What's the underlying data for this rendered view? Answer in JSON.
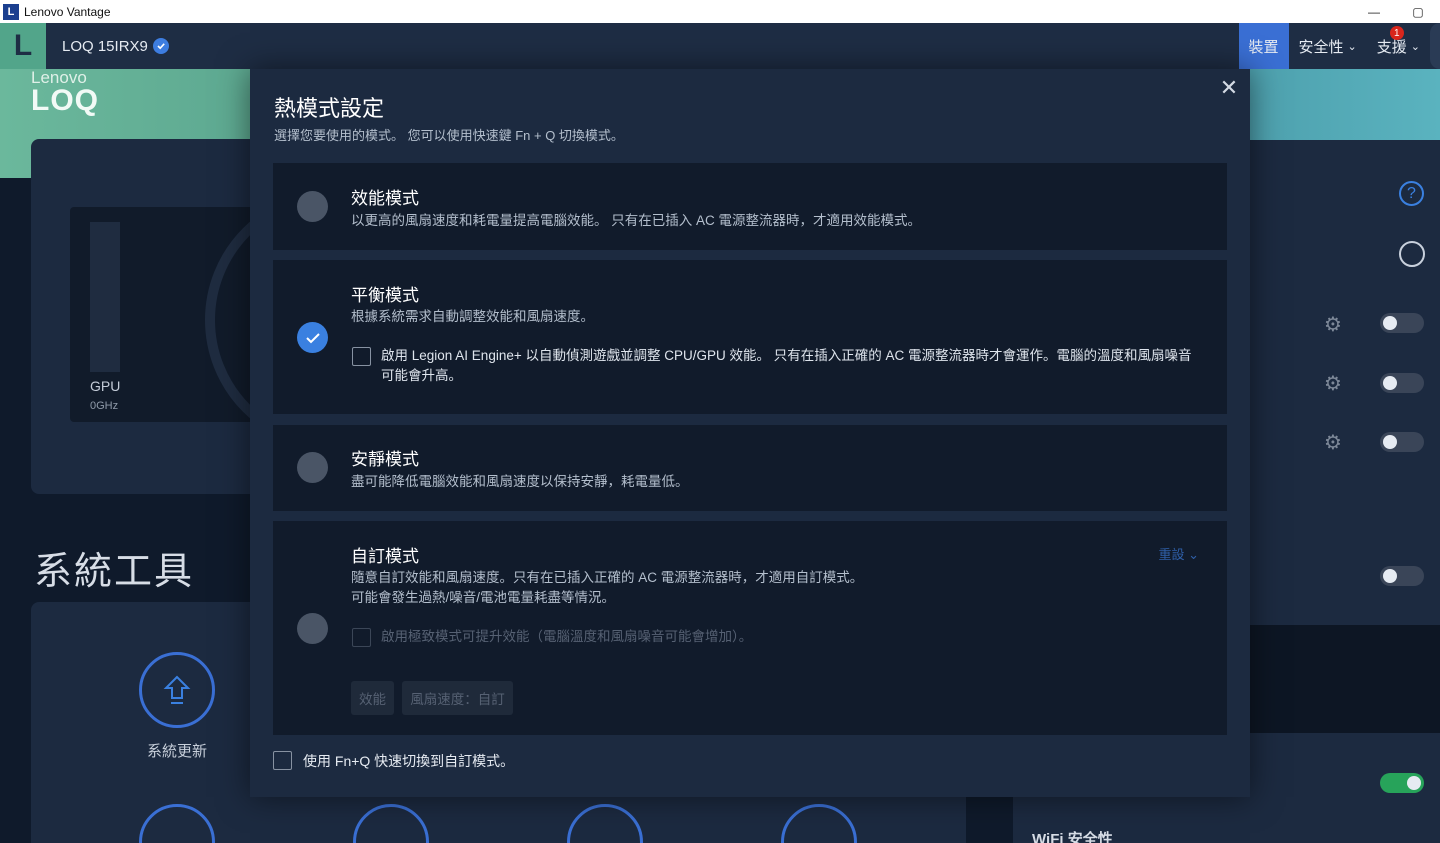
{
  "os": {
    "title": "Lenovo Vantage",
    "logo_letter": "L",
    "minimize": "—",
    "maximize": "▢"
  },
  "header": {
    "logo_letter": "L",
    "device_name": "LOQ 15IRX9",
    "nav": [
      {
        "label": "裝置",
        "active": true
      },
      {
        "label": "安全性",
        "active": false
      },
      {
        "label": "支援",
        "active": false,
        "badge": "1"
      }
    ]
  },
  "background": {
    "brand_top": "Lenovo",
    "brand_bottom": "LOQ",
    "gpu_label": "GPU",
    "gpu_freq": "0GHz",
    "tools_title": "系統工具",
    "tool_update_label": "系統更新",
    "wifi_label": "WiFi 安全性",
    "help_glyph": "?"
  },
  "modal": {
    "title": "熱模式設定",
    "subtitle": "選擇您要使用的模式。 您可以使用快速鍵 Fn + Q 切換模式。",
    "close_glyph": "✕",
    "modes": [
      {
        "title": "效能模式",
        "desc": "以更高的風扇速度和耗電量提高電腦效能。 只有在已插入 AC 電源整流器時，才適用效能模式。",
        "selected": false
      },
      {
        "title": "平衡模式",
        "desc": "根據系統需求自動調整效能和風扇速度。",
        "selected": true,
        "option_line1": "啟用 Legion AI Engine+ 以自動偵測遊戲並調整 CPU/GPU 效能。 只有在插入正確的 AC 電源整流器時才會運作。電腦的溫度和風扇噪音",
        "option_line2": "可能會升高。"
      },
      {
        "title": "安靜模式",
        "desc": "盡可能降低電腦效能和風扇速度以保持安靜，耗電量低。",
        "selected": false
      },
      {
        "title": "自訂模式",
        "desc_line1": "隨意自訂效能和風扇速度。只有在已插入正確的 AC 電源整流器時，才適用自訂模式。",
        "desc_line2": "可能會發生過熱/噪音/電池電量耗盡等情況。",
        "selected": false,
        "reset_label": "重設",
        "option": "啟用極致模式可提升效能（電腦溫度和風扇噪音可能會增加）。",
        "pill_performance": "效能",
        "pill_fan": "風扇速度：自訂"
      }
    ],
    "footer_checkbox": "使用 Fn+Q 快速切換到自訂模式。"
  }
}
